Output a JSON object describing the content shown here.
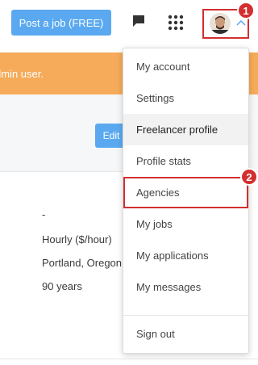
{
  "header": {
    "post_job_label": "Post a job (FREE)",
    "step1": "1",
    "step2": "2"
  },
  "banner": {
    "text": "dmin user."
  },
  "profile": {
    "edit_label": "Edit",
    "fields": [
      "-",
      "Hourly ($/hour)",
      "Portland, Oregon",
      "90 years"
    ]
  },
  "menu": {
    "items": [
      "My account",
      "Settings",
      "Freelancer profile",
      "Profile stats",
      "Agencies",
      "My jobs",
      "My applications",
      "My messages"
    ],
    "sign_out": "Sign out"
  },
  "colors": {
    "accent": "#5aa9f0",
    "banner": "#f5ab59",
    "highlight": "#d32f2f"
  }
}
